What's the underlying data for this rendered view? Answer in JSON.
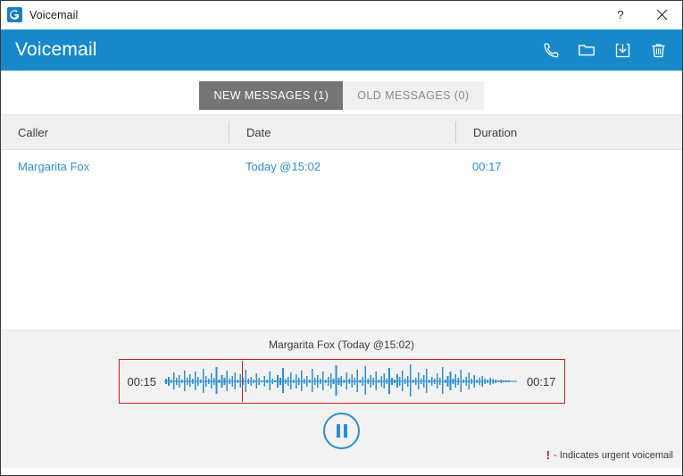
{
  "window": {
    "title": "Voicemail",
    "app_icon": "app-logo-icon",
    "controls": [
      {
        "name": "help-button",
        "label": "?"
      },
      {
        "name": "close-button",
        "label": "✕"
      }
    ]
  },
  "header": {
    "title": "Voicemail",
    "accent_color": "#1789ca",
    "actions": [
      {
        "name": "call-icon",
        "label": "Call"
      },
      {
        "name": "folder-icon",
        "label": "Folder"
      },
      {
        "name": "download-icon",
        "label": "Download"
      },
      {
        "name": "trash-icon",
        "label": "Delete"
      }
    ]
  },
  "tabs": [
    {
      "label": "NEW MESSAGES (1)",
      "active": true
    },
    {
      "label": "OLD MESSAGES (0)",
      "active": false
    }
  ],
  "table": {
    "columns": [
      "Caller",
      "Date",
      "Duration"
    ],
    "rows": [
      {
        "caller": "Margarita Fox",
        "date": "Today @15:02",
        "duration": "00:17"
      }
    ],
    "link_color": "#2a8fd0"
  },
  "player": {
    "title": "Margarita Fox (Today @15:02)",
    "current_time": "00:15",
    "total_time": "00:17",
    "playhead_percent": 22,
    "transport_button": "pause-button",
    "waveform_color": "#2a8fd0",
    "border_color": "#cc1f1f"
  },
  "legend": {
    "marker": "!",
    "text": "- Indicates urgent voicemail",
    "marker_color": "#d01717"
  }
}
